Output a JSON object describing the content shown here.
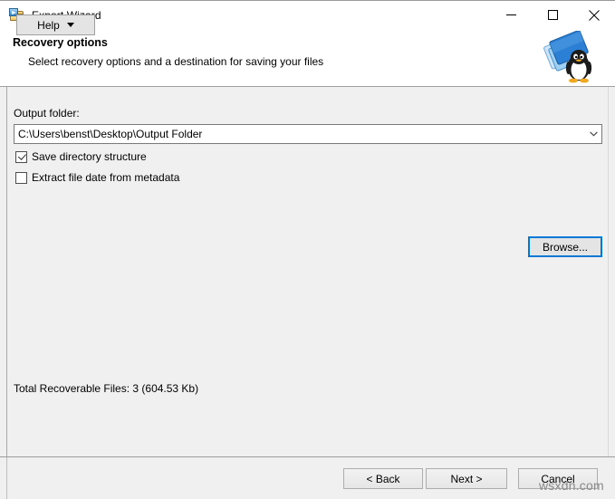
{
  "window": {
    "title": "Export Wizard",
    "icon": "export-folder-icon",
    "controls": {
      "minimize": "minimize-icon",
      "maximize": "maximize-icon",
      "close": "close-icon"
    }
  },
  "header": {
    "title": "Recovery options",
    "subtitle": "Select recovery options and a destination for saving your files",
    "artwork": "blue-folders-with-penguin-icon"
  },
  "main": {
    "output_folder_label": "Output folder:",
    "output_folder_value": "C:\\Users\\benst\\Desktop\\Output Folder",
    "output_folder_dropdown_icon": "chevron-down-icon",
    "browse_label": "Browse...",
    "checkboxes": [
      {
        "label": "Save directory structure",
        "checked": true
      },
      {
        "label": "Extract file date from metadata",
        "checked": false
      }
    ],
    "total_text": "Total Recoverable Files: 3 (604.53 Kb)"
  },
  "footer": {
    "help_label": "Help",
    "help_caret_icon": "caret-down-icon",
    "back_label": "< Back",
    "next_label": "Next >",
    "cancel_label": "Cancel"
  },
  "watermark": "wsxdn.com",
  "colors": {
    "body_background": "#f0f0f0",
    "titlebar_background": "#ffffff",
    "focus_border": "#0078d7",
    "text": "#000000",
    "watermark": "#8a8a8a"
  }
}
